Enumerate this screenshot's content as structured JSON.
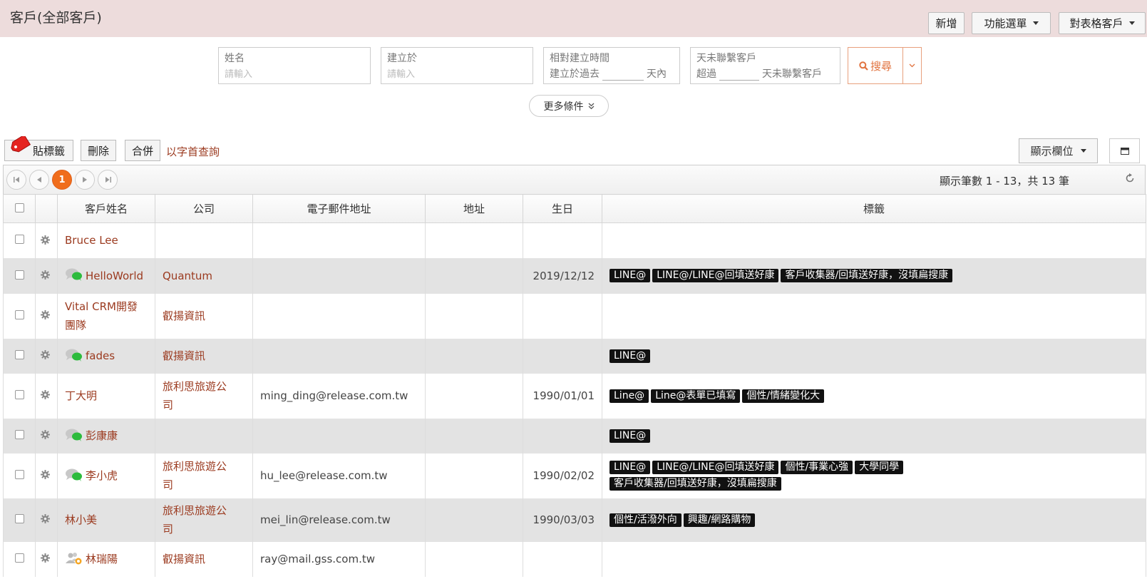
{
  "header": {
    "title": "客戶(全部客戶)",
    "buttons": {
      "add": "新增",
      "menu": "功能選單",
      "sheet": "對表格客戶"
    }
  },
  "filters": {
    "name": {
      "label": "姓名",
      "placeholder": "請輸入"
    },
    "created_at": {
      "label": "建立於",
      "placeholder": "請輸入"
    },
    "relative_created": {
      "label": "相對建立時間",
      "prefix": "建立於過去",
      "suffix": "天內"
    },
    "no_contact": {
      "label": "天未聯繫客戶",
      "prefix": "超過",
      "suffix": "天未聯繫客戶"
    },
    "search_label": "搜尋",
    "more_label": "更多條件"
  },
  "toolbar": {
    "tag_label": "貼標籤",
    "delete_label": "刪除",
    "merge_label": "合併",
    "alpha_link": "以字首查詢",
    "columns_label": "顯示欄位"
  },
  "pager": {
    "current_page": "1",
    "info": "顯示筆數 1 - 13，共 13 筆"
  },
  "columns": {
    "name": "客戶姓名",
    "company": "公司",
    "email": "電子郵件地址",
    "address": "地址",
    "birthday": "生日",
    "tags": "標籤"
  },
  "rows": [
    {
      "icon": "none",
      "name": [
        "Bruce Lee"
      ],
      "company": [],
      "email": "",
      "birthday": "",
      "tags": [
        []
      ]
    },
    {
      "icon": "chat",
      "name": [
        "HelloWorld"
      ],
      "company": [
        "Quantum"
      ],
      "email": "",
      "birthday": "2019/12/12",
      "tags": [
        [
          "LINE@",
          "LINE@/LINE@回填送好康",
          "客戶收集器/回填送好康，沒填扁搜康"
        ]
      ]
    },
    {
      "icon": "none",
      "name": [
        "Vital CRM開發",
        "團隊"
      ],
      "company": [
        "叡揚資訊"
      ],
      "email": "",
      "birthday": "",
      "tags": [
        []
      ]
    },
    {
      "icon": "chat",
      "name": [
        "fades"
      ],
      "company": [
        "叡揚資訊"
      ],
      "email": "",
      "birthday": "",
      "tags": [
        [
          "LINE@"
        ]
      ]
    },
    {
      "icon": "none",
      "name": [
        "丁大明"
      ],
      "company": [
        "旅利思旅遊公",
        "司"
      ],
      "email": "ming_ding@release.com.tw",
      "birthday": "1990/01/01",
      "tags": [
        [
          "Line@",
          "Line@表單已填寫",
          "個性/情緒變化大"
        ]
      ]
    },
    {
      "icon": "chat",
      "name": [
        "彭康康"
      ],
      "company": [],
      "email": "",
      "birthday": "",
      "tags": [
        [
          "LINE@"
        ]
      ]
    },
    {
      "icon": "chat",
      "name": [
        "李小虎"
      ],
      "company": [
        "旅利思旅遊公",
        "司"
      ],
      "email": "hu_lee@release.com.tw",
      "birthday": "1990/02/02",
      "tags": [
        [
          "LINE@",
          "LINE@/LINE@回填送好康",
          "個性/事業心強",
          "大學同學"
        ],
        [
          "客戶收集器/回填送好康，沒填扁搜康"
        ]
      ]
    },
    {
      "icon": "none",
      "name": [
        "林小美"
      ],
      "company": [
        "旅利思旅遊公",
        "司"
      ],
      "email": "mei_lin@release.com.tw",
      "birthday": "1990/03/03",
      "tags": [
        [
          "個性/活潑外向",
          "興趣/網路購物"
        ]
      ]
    },
    {
      "icon": "people",
      "name": [
        "林瑞陽"
      ],
      "company": [
        "叡揚資訊"
      ],
      "email": "ray@mail.gss.com.tw",
      "birthday": "",
      "tags": [
        []
      ]
    }
  ],
  "colors": {
    "header_bg": "#eddcdc",
    "link": "#9b3a1f",
    "accent": "#f06d1c",
    "tag_bg": "#111111",
    "chat_green": "#2dbb3d"
  }
}
